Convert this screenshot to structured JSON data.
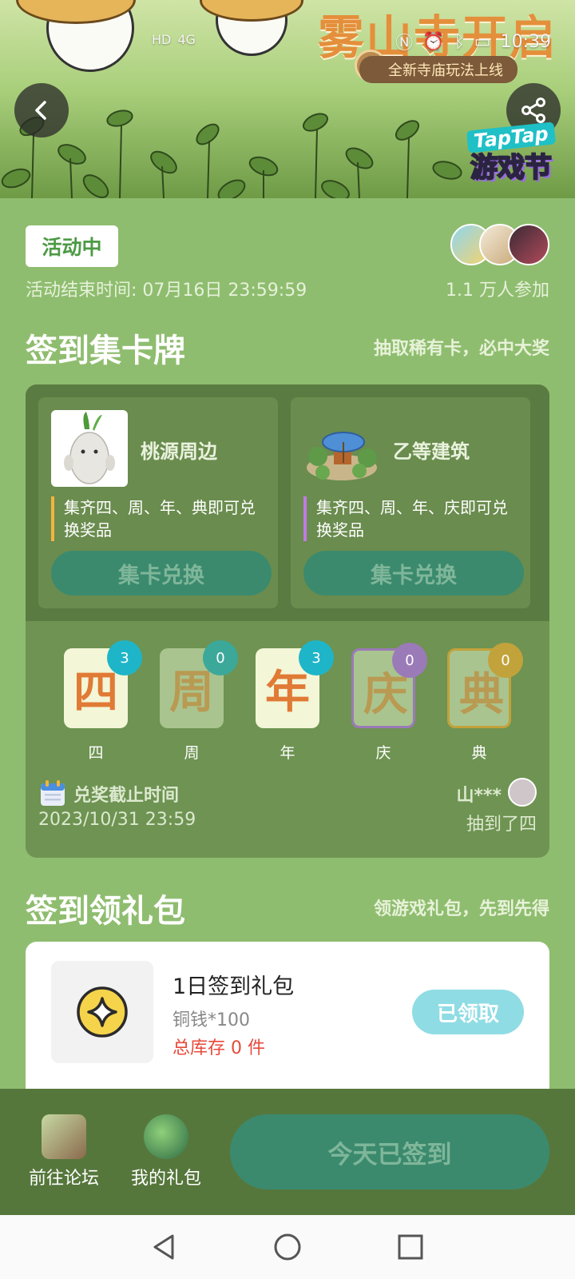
{
  "status_bar": {
    "time": "10:39",
    "network": "4G"
  },
  "banner": {
    "title": "雾山寺开启",
    "subtitle": "全新寺庙玩法上线",
    "badge_top": "TapTap",
    "badge_main": "游戏节"
  },
  "event": {
    "status": "活动中",
    "end_time": "活动结束时间: 07月16日 23:59:59",
    "participants": "1.1 万人参加"
  },
  "card_section": {
    "title": "签到集卡牌",
    "hint": "抽取稀有卡，必中大奖",
    "prizes": [
      {
        "name": "桃源周边",
        "desc": "集齐四、周、年、典即可兑换奖品",
        "button": "集卡兑换",
        "accent": "#f3b43c"
      },
      {
        "name": "乙等建筑",
        "desc": "集齐四、周、年、庆即可兑换奖品",
        "button": "集卡兑换",
        "accent": "#c07ae6"
      }
    ],
    "cards": [
      {
        "glyph": "四",
        "label": "四",
        "count": "3",
        "badge_color": "#1fb5c8"
      },
      {
        "glyph": "周",
        "label": "周",
        "count": "0",
        "badge_color": "#3ba89a"
      },
      {
        "glyph": "年",
        "label": "年",
        "count": "3",
        "badge_color": "#1fb5c8"
      },
      {
        "glyph": "庆",
        "label": "庆",
        "count": "0",
        "badge_color": "#9b7ab8"
      },
      {
        "glyph": "典",
        "label": "典",
        "count": "0",
        "badge_color": "#c2a23a"
      }
    ],
    "deadline_label": "兑奖截止时间",
    "deadline_value": "2023/10/31 23:59",
    "draw_user": "山***",
    "draw_result": "抽到了四"
  },
  "gift_section": {
    "title": "签到领礼包",
    "hint": "领游戏礼包，先到先得",
    "gift": {
      "name": "1日签到礼包",
      "content": "铜钱*100",
      "stock": "总库存 0 件",
      "button": "已领取"
    }
  },
  "bottom_bar": {
    "forum": "前往论坛",
    "my_gifts": "我的礼包",
    "sign_button": "今天已签到"
  }
}
